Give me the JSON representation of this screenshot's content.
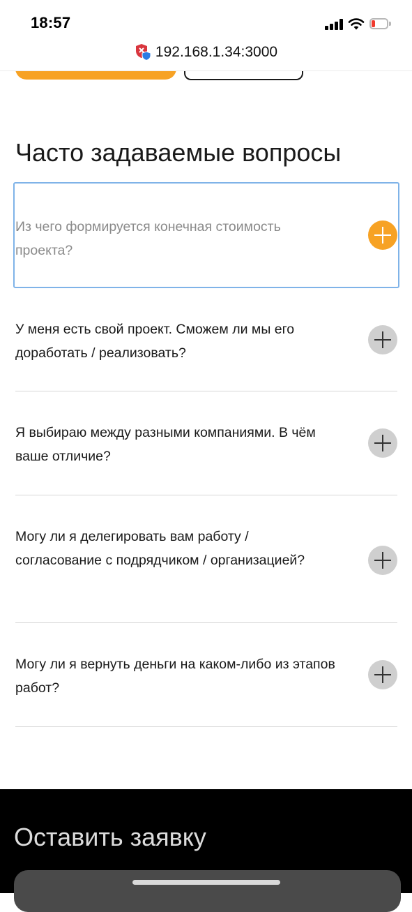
{
  "status_bar": {
    "time": "18:57",
    "icons": [
      "signal-icon",
      "wifi-icon",
      "battery-icon"
    ],
    "battery_color": "#f03a2e"
  },
  "browser": {
    "url": "192.168.1.34:3000",
    "security_icon": "shield-icon"
  },
  "colors": {
    "accent": "#f7a224",
    "focus_border": "#7fb3e8",
    "footer_bg": "#000000"
  },
  "faq": {
    "title": "Часто задаваемые вопросы",
    "items": [
      {
        "question": "Из чего формируется конечная стоимость проекта?",
        "state": "focused"
      },
      {
        "question": "У меня есть свой проект. Сможем ли мы его доработать / реализовать?",
        "state": "collapsed"
      },
      {
        "question": "Я выбираю между разными компаниями. В чём ваше отличие?",
        "state": "collapsed"
      },
      {
        "question": "Могу ли я делегировать вам работу / согласование с подрядчиком / организацией?",
        "state": "collapsed"
      },
      {
        "question": "Могу ли я вернуть деньги на каком-либо из этапов работ?",
        "state": "collapsed"
      }
    ]
  },
  "request": {
    "title": "Оставить заявку"
  }
}
